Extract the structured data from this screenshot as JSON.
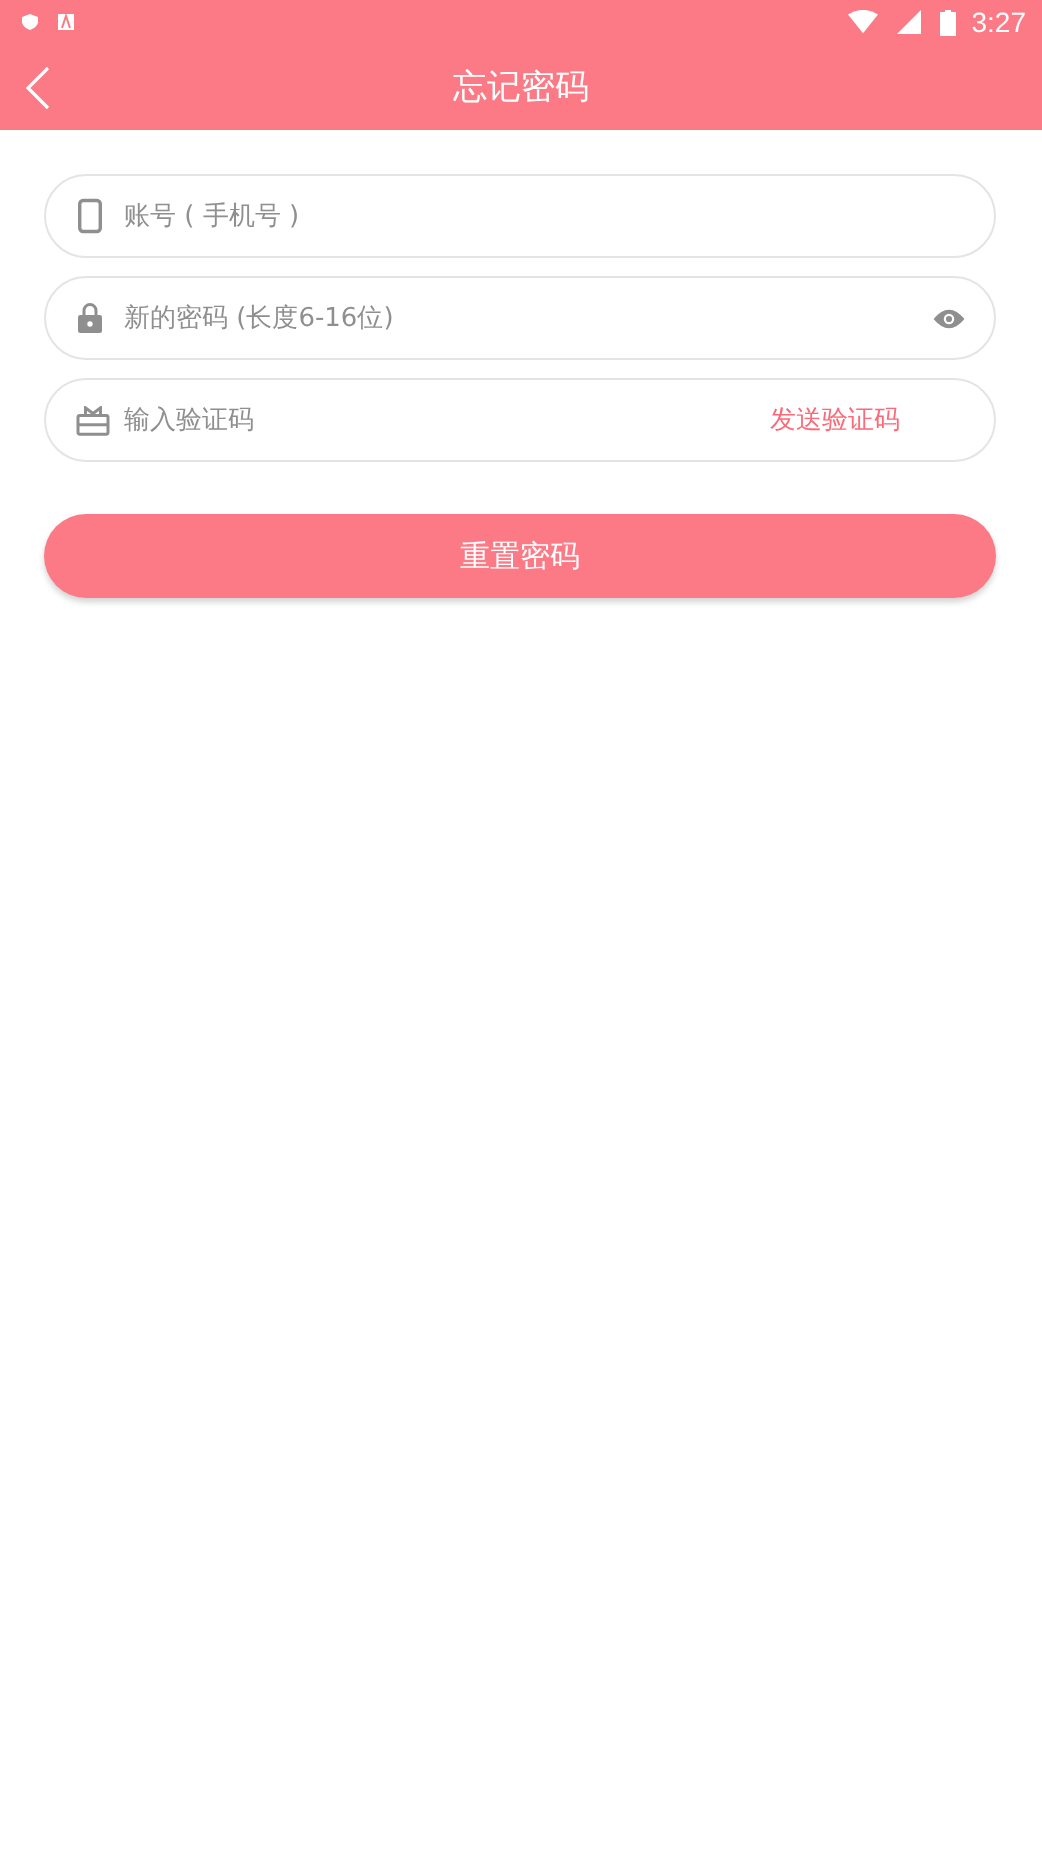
{
  "status_bar": {
    "time": "3:27"
  },
  "toolbar": {
    "title": "忘记密码"
  },
  "fields": [
    {
      "kind": "phone",
      "placeholder": "账号 ( 手机号 )"
    },
    {
      "kind": "password",
      "placeholder": "新的密码 (长度6-16位)"
    },
    {
      "kind": "code",
      "placeholder": "输入验证码",
      "action": "发送验证码"
    }
  ],
  "submit": {
    "label": "重置密码"
  }
}
